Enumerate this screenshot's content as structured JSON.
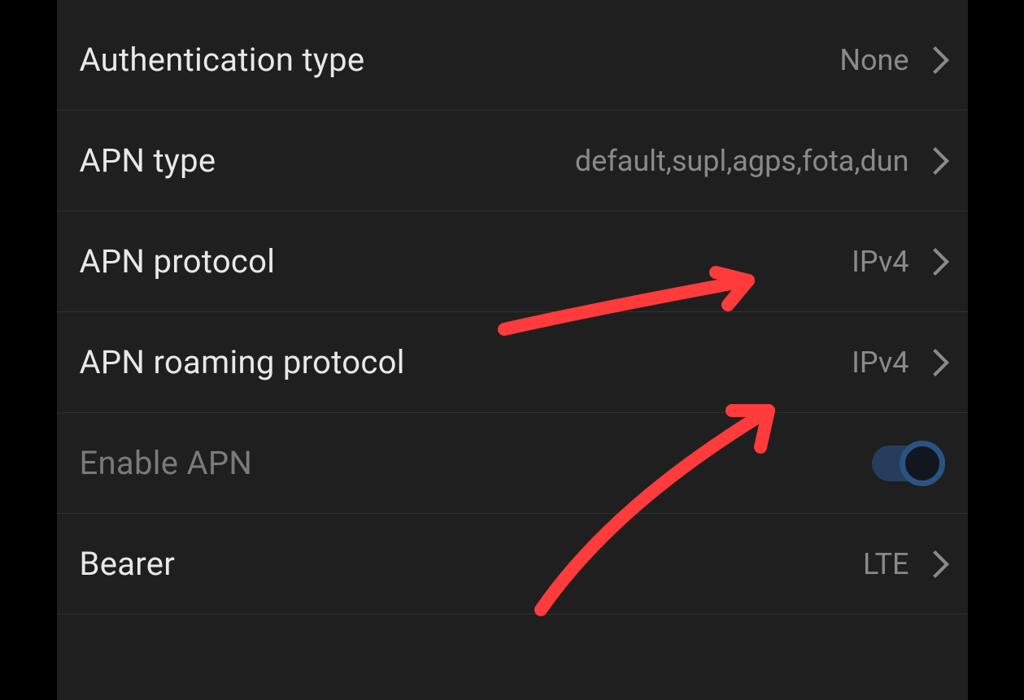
{
  "settings": {
    "auth_type": {
      "label": "Authentication type",
      "value": "None"
    },
    "apn_type": {
      "label": "APN type",
      "value": "default,supl,agps,fota,dun"
    },
    "apn_protocol": {
      "label": "APN protocol",
      "value": "IPv4"
    },
    "apn_roaming_protocol": {
      "label": "APN roaming protocol",
      "value": "IPv4"
    },
    "enable_apn": {
      "label": "Enable APN",
      "value": true
    },
    "bearer": {
      "label": "Bearer",
      "value": "LTE"
    }
  },
  "colors": {
    "background": "#1f1f1f",
    "text_primary": "#e8e8e8",
    "text_secondary": "#8a8a8a",
    "text_disabled": "#7a7a7a",
    "divider": "#313131",
    "toggle_track": "#2a4a7a",
    "toggle_ring": "#2f6aad",
    "annotation": "#ff3b3b"
  }
}
